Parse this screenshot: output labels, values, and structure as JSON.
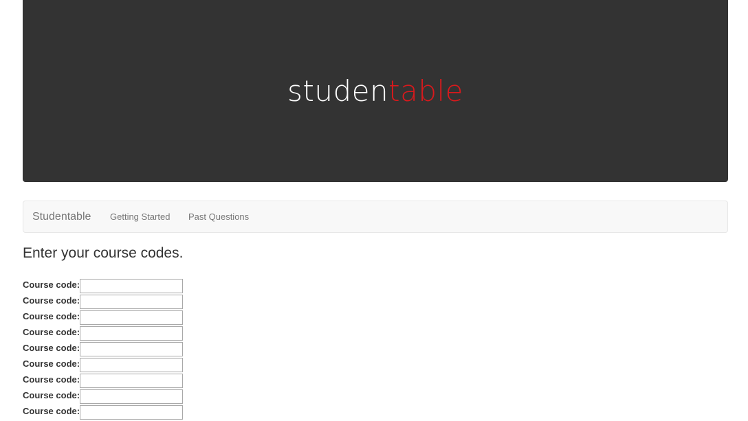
{
  "banner": {
    "logo_part_a": "studen",
    "logo_part_b": "table"
  },
  "navbar": {
    "brand": "Studentable",
    "links": [
      "Getting Started",
      "Past Questions"
    ]
  },
  "main": {
    "heading": "Enter your course codes.",
    "fields": [
      {
        "label": "Course code:",
        "value": ""
      },
      {
        "label": "Course code:",
        "value": ""
      },
      {
        "label": "Course code:",
        "value": ""
      },
      {
        "label": "Course code:",
        "value": ""
      },
      {
        "label": "Course code:",
        "value": ""
      },
      {
        "label": "Course code:",
        "value": ""
      },
      {
        "label": "Course code:",
        "value": ""
      },
      {
        "label": "Course code:",
        "value": ""
      },
      {
        "label": "Course code:",
        "value": ""
      }
    ]
  },
  "colors": {
    "banner_bg": "#333333",
    "logo_white": "#ffffff",
    "logo_red": "#d9191c",
    "navbar_bg": "#f8f8f8"
  }
}
